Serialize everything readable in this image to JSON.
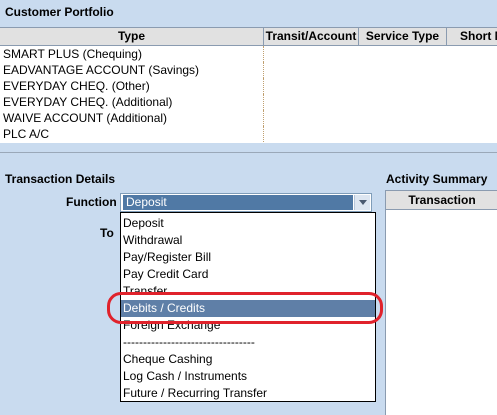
{
  "portfolio": {
    "title": "Customer Portfolio",
    "columns": [
      "Type",
      "Transit/Account",
      "Service Type",
      "Short N"
    ],
    "rows": [
      {
        "type": "SMART PLUS (Chequing)"
      },
      {
        "type": "EADVANTAGE ACCOUNT (Savings)"
      },
      {
        "type": "EVERYDAY CHEQ. (Other)"
      },
      {
        "type": "EVERYDAY CHEQ. (Additional)"
      },
      {
        "type": "WAIVE ACCOUNT (Additional)"
      },
      {
        "type": "PLC A/C"
      }
    ]
  },
  "transaction_details": {
    "title": "Transaction Details",
    "function_label": "Function",
    "to_label": "To",
    "function_selected": "Deposit",
    "dropdown_options": [
      "Deposit",
      "Withdrawal",
      "Pay/Register Bill",
      "Pay Credit Card",
      "Transfer",
      "Debits / Credits",
      "Foreign Exchange",
      "---------------------------------",
      "Cheque Cashing",
      "Log Cash / Instruments",
      "Future / Recurring Transfer"
    ],
    "highlighted_option": "Debits / Credits"
  },
  "activity_summary": {
    "title": "Activity Summary",
    "column": "Transaction"
  },
  "colors": {
    "background": "#c9dbef",
    "selection": "#5f7fa7",
    "highlight_ring": "#e0222b"
  }
}
